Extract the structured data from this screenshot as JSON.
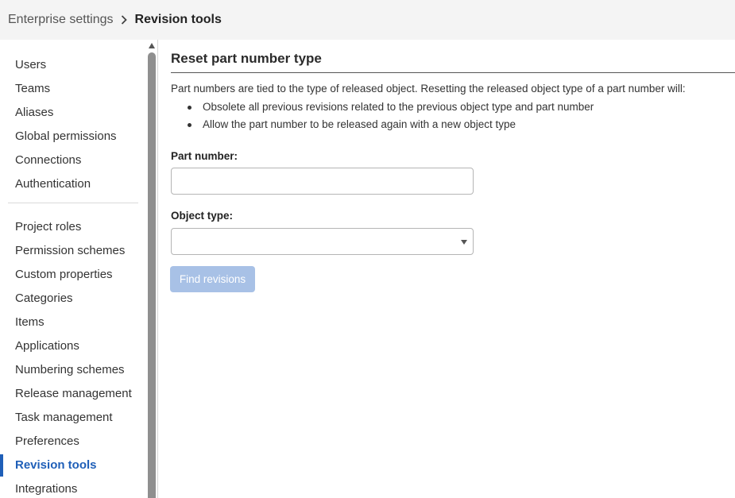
{
  "breadcrumb": {
    "parent": "Enterprise settings",
    "current": "Revision tools"
  },
  "sidebar": {
    "group1": [
      "Users",
      "Teams",
      "Aliases",
      "Global permissions",
      "Connections",
      "Authentication"
    ],
    "group2": [
      "Project roles",
      "Permission schemes",
      "Custom properties",
      "Categories",
      "Items",
      "Applications",
      "Numbering schemes",
      "Release management",
      "Task management",
      "Preferences",
      "Revision tools",
      "Integrations"
    ],
    "active": "Revision tools"
  },
  "main": {
    "title": "Reset part number type",
    "intro": "Part numbers are tied to the type of released object. Resetting the released object type of a part number will:",
    "bullets": [
      "Obsolete all previous revisions related to the previous object type and part number",
      "Allow the part number to be released again with a new object type"
    ],
    "part_number_label": "Part number:",
    "part_number_value": "",
    "object_type_label": "Object type:",
    "object_type_value": "",
    "find_button": "Find revisions"
  },
  "colors": {
    "accent": "#1f5fb8",
    "button_disabled": "#a8c1e6",
    "topbar": "#f4f4f4"
  }
}
